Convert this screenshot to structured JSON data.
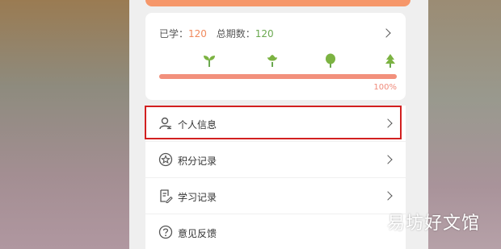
{
  "progress_card": {
    "learned_label": "已学：",
    "learned_value": "120",
    "total_label": "总期数：",
    "total_value": "120",
    "progress_fraction": 1.0,
    "progress_text": "100%",
    "stage_icons": [
      "sprout-icon",
      "bud-icon",
      "tree-icon",
      "pine-tree-icon"
    ]
  },
  "menu": {
    "items": [
      {
        "label": "个人信息",
        "icon": "user-profile-icon"
      },
      {
        "label": "积分记录",
        "icon": "star-badge-icon"
      },
      {
        "label": "学习记录",
        "icon": "notebook-edit-icon"
      },
      {
        "label": "意见反馈",
        "icon": "question-circle-icon"
      }
    ]
  },
  "highlight": {
    "target": "个人信息"
  },
  "watermark": {
    "text": "易坊好文馆"
  },
  "colors": {
    "accent_orange": "#f6976a",
    "progress_fill": "#f2907c",
    "green": "#6aa84f",
    "highlight_red": "#d22020"
  }
}
